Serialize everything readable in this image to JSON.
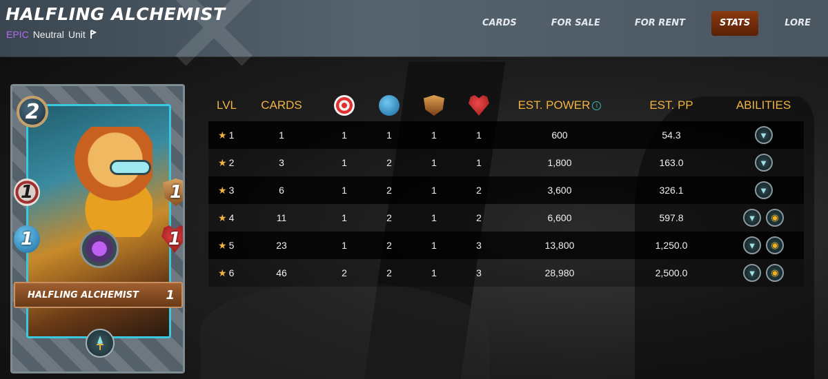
{
  "header": {
    "title": "HALFLING ALCHEMIST",
    "rarity": "EPIC",
    "element": "Neutral",
    "type": "Unit",
    "nav": [
      {
        "label": "CARDS",
        "active": false
      },
      {
        "label": "FOR SALE",
        "active": false
      },
      {
        "label": "FOR RENT",
        "active": false
      },
      {
        "label": "STATS",
        "active": true
      },
      {
        "label": "LORE",
        "active": false
      }
    ]
  },
  "card": {
    "name": "HALFLING ALCHEMIST",
    "level": "1",
    "mana": "2",
    "ranged": "1",
    "armor": "1",
    "speed": "1",
    "health": "1",
    "ability_icon": "dagger-icon"
  },
  "stats": {
    "headers": {
      "lvl": "LVL",
      "cards": "CARDS",
      "ranged_icon": "ranged-attack-icon",
      "speed_icon": "speed-icon",
      "armor_icon": "armor-icon",
      "health_icon": "health-icon",
      "power": "EST. POWER",
      "pp": "EST. PP",
      "abilities": "ABILITIES"
    },
    "rows": [
      {
        "lvl": "1",
        "cards": "1",
        "ranged": "1",
        "speed": "1",
        "armor": "1",
        "health": "1",
        "power": "600",
        "pp": "54.3",
        "abilities": [
          "scavenger-icon"
        ]
      },
      {
        "lvl": "2",
        "cards": "3",
        "ranged": "1",
        "speed": "2",
        "armor": "1",
        "health": "1",
        "power": "1,800",
        "pp": "163.0",
        "abilities": [
          "scavenger-icon"
        ]
      },
      {
        "lvl": "3",
        "cards": "6",
        "ranged": "1",
        "speed": "2",
        "armor": "1",
        "health": "2",
        "power": "3,600",
        "pp": "326.1",
        "abilities": [
          "scavenger-icon"
        ]
      },
      {
        "lvl": "4",
        "cards": "11",
        "ranged": "1",
        "speed": "2",
        "armor": "1",
        "health": "2",
        "power": "6,600",
        "pp": "597.8",
        "abilities": [
          "scavenger-icon",
          "gold-coin-icon"
        ]
      },
      {
        "lvl": "5",
        "cards": "23",
        "ranged": "1",
        "speed": "2",
        "armor": "1",
        "health": "3",
        "power": "13,800",
        "pp": "1,250.0",
        "abilities": [
          "scavenger-icon",
          "gold-coin-icon"
        ]
      },
      {
        "lvl": "6",
        "cards": "46",
        "ranged": "2",
        "speed": "2",
        "armor": "1",
        "health": "3",
        "power": "28,980",
        "pp": "2,500.0",
        "abilities": [
          "scavenger-icon",
          "gold-coin-icon"
        ]
      }
    ]
  },
  "colors": {
    "accent": "#f2b340",
    "rarity_epic": "#b46bf0",
    "active_tab": "#8a3a10"
  }
}
